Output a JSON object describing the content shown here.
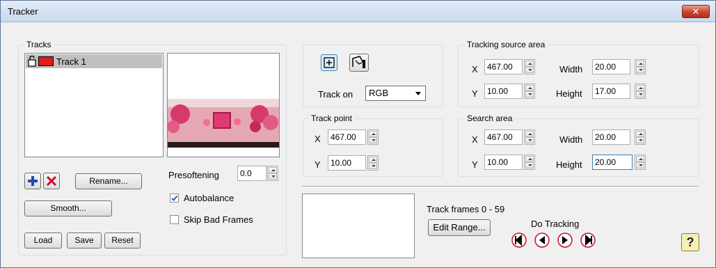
{
  "window": {
    "title": "Tracker",
    "close_glyph": "✕"
  },
  "tracks": {
    "group_label": "Tracks",
    "items": [
      {
        "label": "Track 1",
        "color": "#e11b1b"
      }
    ],
    "rename_label": "Rename...",
    "smooth_label": "Smooth...",
    "load_label": "Load",
    "save_label": "Save",
    "reset_label": "Reset",
    "presoftening_label": "Presoftening",
    "presoftening_value": "0.0",
    "autobalance_label": "Autobalance",
    "autobalance_checked": true,
    "skip_bad_frames_label": "Skip Bad Frames",
    "skip_bad_frames_checked": false
  },
  "track_on": {
    "label": "Track on",
    "value": "RGB"
  },
  "track_point": {
    "group_label": "Track point",
    "x_label": "X",
    "x_value": "467.00",
    "y_label": "Y",
    "y_value": "10.00"
  },
  "tracking_source_area": {
    "group_label": "Tracking source area",
    "x_label": "X",
    "x_value": "467.00",
    "y_label": "Y",
    "y_value": "10.00",
    "width_label": "Width",
    "width_value": "20.00",
    "height_label": "Height",
    "height_value": "17.00"
  },
  "search_area": {
    "group_label": "Search area",
    "x_label": "X",
    "x_value": "467.00",
    "y_label": "Y",
    "y_value": "10.00",
    "width_label": "Width",
    "width_value": "20.00",
    "height_label": "Height",
    "height_value": "20.00"
  },
  "tracking": {
    "frames_label": "Track frames 0 - 59",
    "edit_range_label": "Edit Range...",
    "do_tracking_label": "Do Tracking",
    "help_glyph": "?"
  },
  "colors": {
    "accent": "#1f5fbf",
    "danger": "#c8102e",
    "title_bg": "#d6e3f3"
  }
}
